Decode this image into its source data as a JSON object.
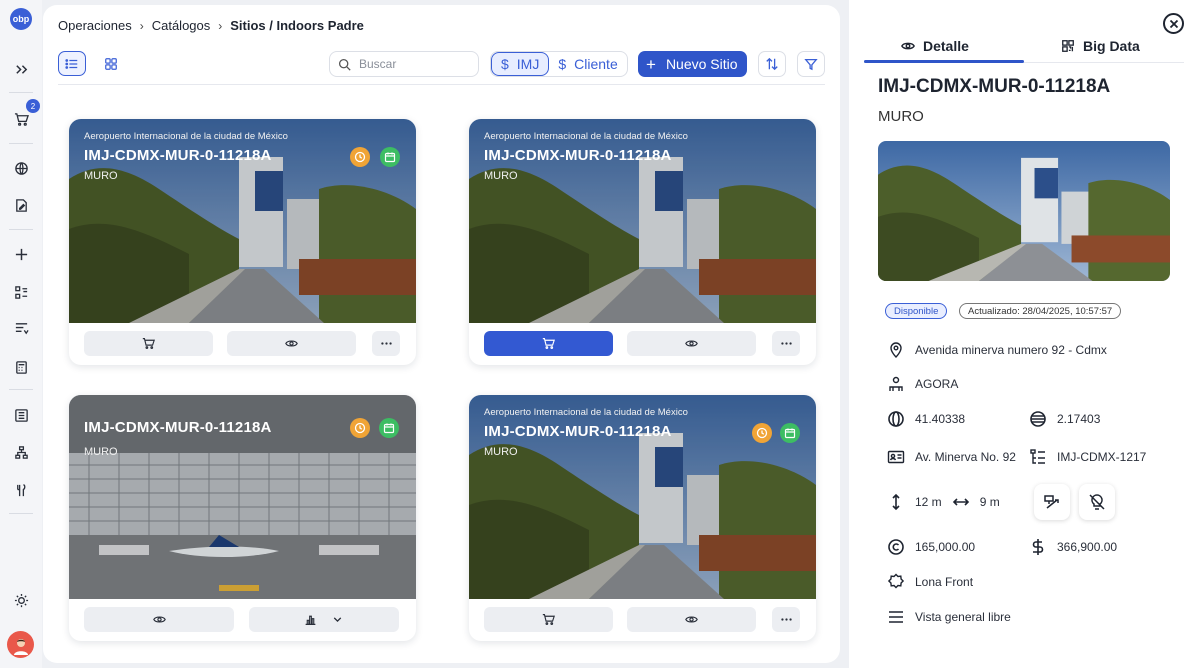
{
  "app": {
    "logo_text": "obp"
  },
  "rail": {
    "cart_badge": "2"
  },
  "breadcrumb": {
    "items": [
      "Operaciones",
      "Catálogos"
    ],
    "current": "Sitios / Indoors Padre"
  },
  "toolbar": {
    "search_placeholder": "Buscar",
    "currency_imj": "IMJ",
    "currency_cliente": "Cliente",
    "currency_symbol": "$",
    "new_site_label": "Nuevo Sitio"
  },
  "cards": [
    {
      "address": "Aeropuerto Internacional de la ciudad de México",
      "code": "IMJ-CDMX-MUR-0-11218A",
      "type": "MURO"
    },
    {
      "address": "Aeropuerto Internacional de la ciudad de México",
      "code": "IMJ-CDMX-MUR-0-11218A",
      "type": "MURO"
    },
    {
      "address": "",
      "code": "IMJ-CDMX-MUR-0-11218A",
      "type": "MURO"
    },
    {
      "address": "Aeropuerto Internacional de la ciudad de México",
      "code": "IMJ-CDMX-MUR-0-11218A",
      "type": "MURO"
    }
  ],
  "detail": {
    "tabs": {
      "detalle": "Detalle",
      "big_data": "Big Data"
    },
    "code": "IMJ-CDMX-MUR-0-11218A",
    "type": "MURO",
    "status": "Disponible",
    "updated": "Actualizado: 28/04/2025, 10:57:57",
    "address": "Avenida minerva numero 92 - Cdmx",
    "owner": "AGORA",
    "latitude": "41.40338",
    "longitude": "2.17403",
    "street": "Av. Minerva No. 92",
    "ref_code": "IMJ-CDMX-1217",
    "height": "12 m",
    "width": "9 m",
    "cost": "165,000.00",
    "price": "366,900.00",
    "material": "Lona Front",
    "view": "Vista general libre"
  },
  "colors": {
    "accent": "#2f55c9",
    "clock": "#f0a436",
    "calendar": "#3dbd63"
  }
}
